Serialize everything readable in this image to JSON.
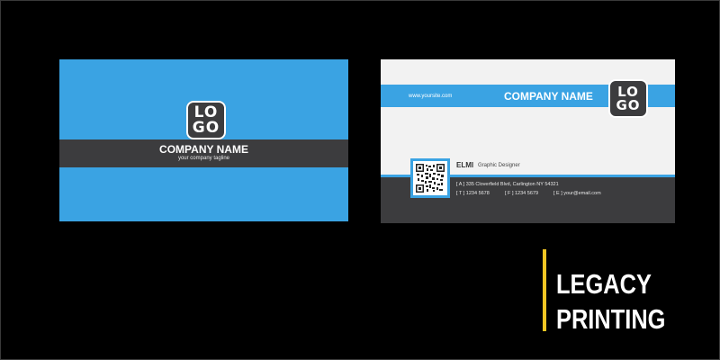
{
  "front_card": {
    "logo": {
      "line1": "LO",
      "line2": "GO"
    },
    "company_name": "COMPANY NAME",
    "tagline": "your company tagline"
  },
  "back_card": {
    "website": "www.yoursite.com",
    "company_name": "COMPANY NAME",
    "logo": {
      "line1": "LO",
      "line2": "GO"
    },
    "name": "ELMI",
    "role": "Graphic Designer",
    "address": "[ A ]  335 Cloverfield Blvd, Carlington NY 54321",
    "phone": "[ T ]  1234 5678",
    "fax": "[ F ]  1234 5679",
    "email": "[ E ]  your@email.com"
  },
  "brand": {
    "line1": "LEGACY",
    "line2": "PRINTING"
  },
  "colors": {
    "background": "#000000",
    "card_blue": "#3aa3e3",
    "card_dark": "#3c3c3e",
    "card_paper": "#f2f2f2",
    "brand_accent": "#f3c623"
  }
}
